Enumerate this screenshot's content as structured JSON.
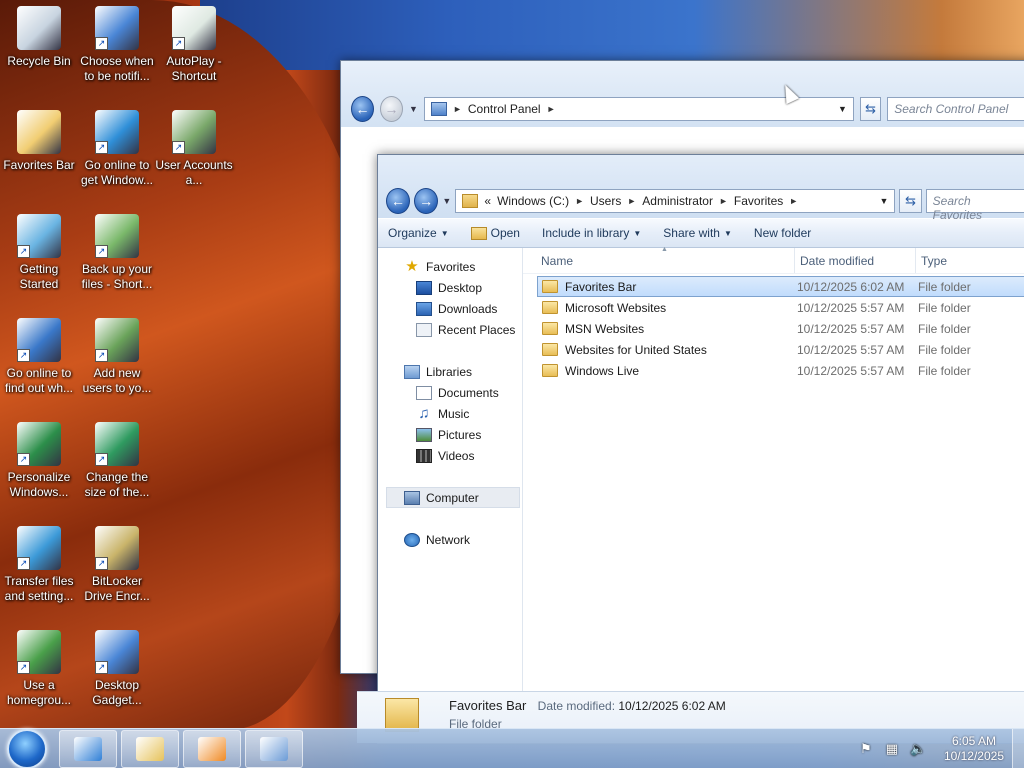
{
  "desktop": {
    "icons": [
      {
        "label": "Recycle Bin",
        "icon": "recycle-bin-icon",
        "color": "#c8d4e0"
      },
      {
        "label": "Choose when to be notifi...",
        "icon": "shield-icon",
        "color": "#4a86d6"
      },
      {
        "label": "AutoPlay - Shortcut",
        "icon": "autoplay-icon",
        "color": "#dfe9e2"
      },
      {
        "label": "Favorites Bar",
        "icon": "folder-icon",
        "color": "#f1cd72"
      },
      {
        "label": "Go online to get Window...",
        "icon": "windows-flag-icon",
        "color": "#2f8fd8"
      },
      {
        "label": "User Accounts a...",
        "icon": "users-icon",
        "color": "#7aa86a"
      },
      {
        "label": "Getting Started",
        "icon": "document-icon",
        "color": "#6ab4e2"
      },
      {
        "label": "Back up your files - Short...",
        "icon": "backup-icon",
        "color": "#7ab86a"
      },
      {
        "label": "Go online to find out wh...",
        "icon": "monitor-windows-icon",
        "color": "#3a78c9"
      },
      {
        "label": "Add new users to yo...",
        "icon": "add-users-icon",
        "color": "#6aa35a"
      },
      {
        "label": "Personalize Windows...",
        "icon": "monitor-personalize-icon",
        "color": "#2c8f4a"
      },
      {
        "label": "Change the size of the...",
        "icon": "monitor-display-icon",
        "color": "#2f9b60"
      },
      {
        "label": "Transfer files and setting...",
        "icon": "transfer-icon",
        "color": "#3c9ad8"
      },
      {
        "label": "BitLocker Drive Encr...",
        "icon": "bitlocker-icon",
        "color": "#c9b46a"
      },
      {
        "label": "Use a homegrou...",
        "icon": "homegroup-icon",
        "color": "#4aa04a"
      },
      {
        "label": "Desktop Gadget...",
        "icon": "gadget-icon",
        "color": "#4a86d6"
      }
    ]
  },
  "control_panel_window": {
    "address_root": "Control Panel",
    "search_placeholder": "Search Control Panel"
  },
  "explorer": {
    "address": {
      "overflow": "«",
      "crumbs": [
        "Windows (C:)",
        "Users",
        "Administrator",
        "Favorites"
      ]
    },
    "search_placeholder": "Search Favorites",
    "toolbar": {
      "organize": "Organize",
      "open": "Open",
      "include_in_library": "Include in library",
      "share_with": "Share with",
      "new_folder": "New folder"
    },
    "nav": {
      "favorites": "Favorites",
      "desktop": "Desktop",
      "downloads": "Downloads",
      "recent_places": "Recent Places",
      "libraries": "Libraries",
      "documents": "Documents",
      "music": "Music",
      "pictures": "Pictures",
      "videos": "Videos",
      "computer": "Computer",
      "network": "Network"
    },
    "columns": {
      "name": "Name",
      "date_modified": "Date modified",
      "type": "Type"
    },
    "files": [
      {
        "name": "Favorites Bar",
        "date": "10/12/2025 6:02 AM",
        "type": "File folder",
        "selected": true
      },
      {
        "name": "Microsoft Websites",
        "date": "10/12/2025 5:57 AM",
        "type": "File folder",
        "selected": false
      },
      {
        "name": "MSN Websites",
        "date": "10/12/2025 5:57 AM",
        "type": "File folder",
        "selected": false
      },
      {
        "name": "Websites for United States",
        "date": "10/12/2025 5:57 AM",
        "type": "File folder",
        "selected": false
      },
      {
        "name": "Windows Live",
        "date": "10/12/2025 5:57 AM",
        "type": "File folder",
        "selected": false
      }
    ],
    "details": {
      "name": "Favorites Bar",
      "date_label": "Date modified:",
      "date_value": "10/12/2025 6:02 AM",
      "type": "File folder"
    }
  },
  "taskbar": {
    "buttons": [
      {
        "name": "internet-explorer-icon",
        "color": "#2f7fd6"
      },
      {
        "name": "windows-explorer-icon",
        "color": "#e6c25a"
      },
      {
        "name": "media-player-icon",
        "color": "#f08a24"
      },
      {
        "name": "control-panel-icon",
        "color": "#6a9ad6"
      }
    ],
    "clock": {
      "time": "6:05 AM",
      "date": "10/12/2025"
    }
  }
}
